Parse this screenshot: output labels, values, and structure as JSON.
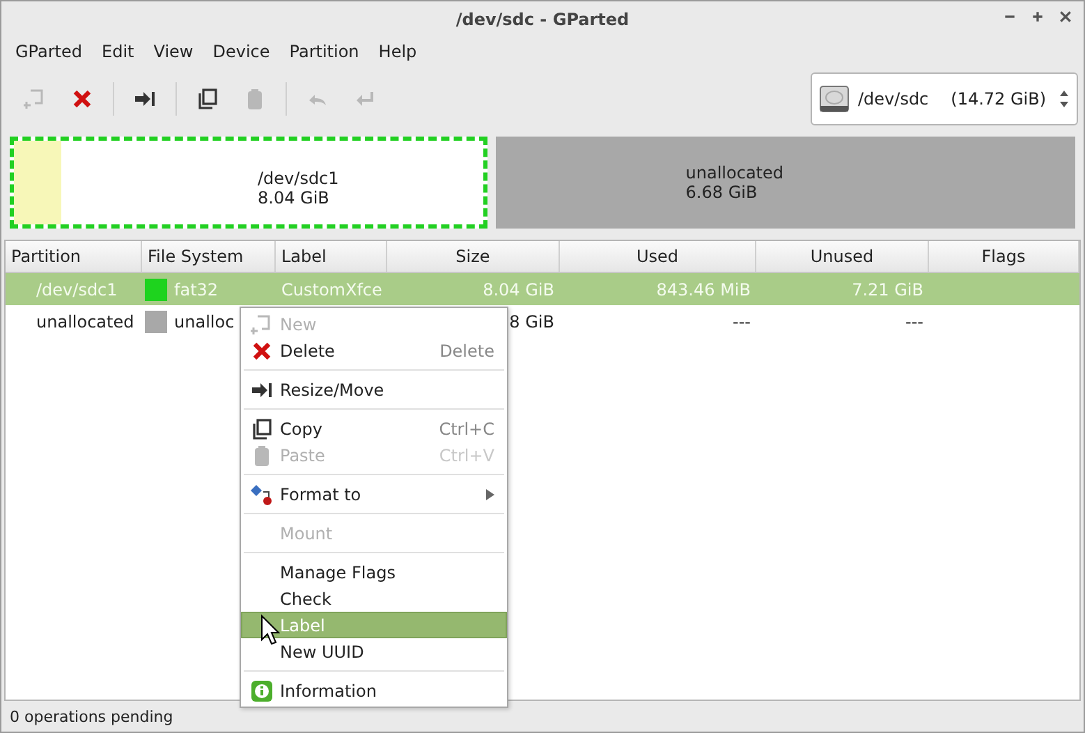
{
  "window": {
    "title": "/dev/sdc - GParted"
  },
  "menubar": [
    "GParted",
    "Edit",
    "View",
    "Device",
    "Partition",
    "Help"
  ],
  "toolbar": [
    {
      "kind": "new",
      "disabled": true
    },
    {
      "kind": "delete",
      "disabled": false
    },
    {
      "kind": "sep"
    },
    {
      "kind": "resize",
      "disabled": false
    },
    {
      "kind": "sep"
    },
    {
      "kind": "copy",
      "disabled": false
    },
    {
      "kind": "paste",
      "disabled": true
    },
    {
      "kind": "sep"
    },
    {
      "kind": "undo",
      "disabled": true
    },
    {
      "kind": "apply",
      "disabled": true
    }
  ],
  "device": {
    "name": "/dev/sdc",
    "size": "(14.72 GiB)"
  },
  "disk_map": [
    {
      "kind": "partition",
      "name": "/dev/sdc1",
      "size": "8.04 GiB",
      "selected": true,
      "level": 0.1
    },
    {
      "kind": "unallocated",
      "name": "unallocated",
      "size": "6.68 GiB",
      "selected": false
    }
  ],
  "table": {
    "columns": [
      "Partition",
      "File System",
      "Label",
      "Size",
      "Used",
      "Unused",
      "Flags"
    ],
    "rows": [
      {
        "partition": "/dev/sdc1",
        "color": "#1ed31e",
        "file_system": "fat32",
        "label": "CustomXfce",
        "size": "8.04 GiB",
        "used": "843.46 MiB",
        "unused": "7.21 GiB",
        "selected": true
      },
      {
        "partition": "unallocated",
        "color": "#a8a8a8",
        "file_system": "unalloc",
        "size": "8 GiB",
        "used": "---",
        "unused": "---",
        "selected": false
      }
    ]
  },
  "context_menu": [
    {
      "kind": "new",
      "label": "New",
      "disabled": true,
      "selected": false
    },
    {
      "kind": "delete",
      "label": "Delete",
      "shortcut": "Delete",
      "disabled": false,
      "selected": false
    },
    {
      "kind": "sep"
    },
    {
      "kind": "resize",
      "label": "Resize/Move",
      "disabled": false,
      "selected": false
    },
    {
      "kind": "sep"
    },
    {
      "kind": "copy",
      "label": "Copy",
      "shortcut": "Ctrl+C",
      "disabled": false,
      "selected": false
    },
    {
      "kind": "paste",
      "label": "Paste",
      "shortcut": "Ctrl+V",
      "disabled": true,
      "selected": false
    },
    {
      "kind": "sep"
    },
    {
      "kind": "format",
      "label": "Format to",
      "submenu": true,
      "disabled": false,
      "selected": false
    },
    {
      "kind": "sep"
    },
    {
      "kind": "text",
      "label": "Mount",
      "disabled": true,
      "selected": false
    },
    {
      "kind": "sep"
    },
    {
      "kind": "text",
      "label": "Manage Flags",
      "disabled": false,
      "selected": false
    },
    {
      "kind": "text",
      "label": "Check",
      "disabled": false,
      "selected": false
    },
    {
      "kind": "text",
      "label": "Label",
      "disabled": false,
      "selected": true
    },
    {
      "kind": "text",
      "label": "New UUID",
      "disabled": false,
      "selected": false
    },
    {
      "kind": "sep"
    },
    {
      "kind": "info",
      "label": "Information",
      "disabled": false,
      "selected": false
    }
  ],
  "status_bar": "0 operations pending"
}
